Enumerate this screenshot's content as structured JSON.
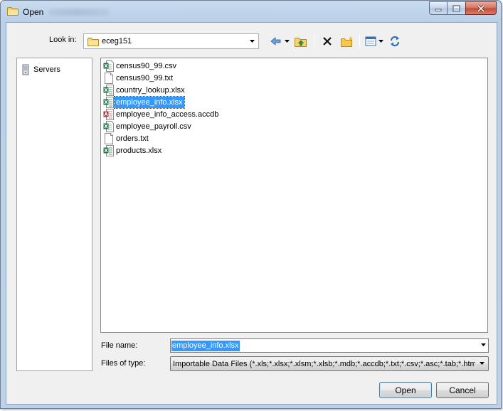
{
  "window": {
    "title": "Open",
    "minimize_icon": "minimize-icon",
    "maximize_icon": "maximize-icon",
    "close_icon": "close-icon"
  },
  "lookin": {
    "label": "Look in:",
    "value": "eceg151",
    "icon": "folder-icon"
  },
  "toolbar": {
    "buttons": [
      {
        "name": "back-button",
        "icon": "back-arrow-icon"
      },
      {
        "name": "up-folder-button",
        "icon": "up-folder-icon"
      },
      {
        "name": "delete-button",
        "icon": "delete-x-icon"
      },
      {
        "name": "new-folder-button",
        "icon": "new-folder-icon"
      },
      {
        "name": "views-button",
        "icon": "views-icon"
      },
      {
        "name": "refresh-button",
        "icon": "refresh-icon"
      }
    ]
  },
  "places": {
    "items": [
      {
        "label": "Servers",
        "icon": "server-icon"
      }
    ]
  },
  "files": [
    {
      "name": "census90_99.csv",
      "icon": "excel-csv-icon",
      "selected": false
    },
    {
      "name": "census90_99.txt",
      "icon": "text-file-icon",
      "selected": false
    },
    {
      "name": "country_lookup.xlsx",
      "icon": "excel-icon",
      "selected": false
    },
    {
      "name": "employee_info.xlsx",
      "icon": "excel-icon",
      "selected": true
    },
    {
      "name": "employee_info_access.accdb",
      "icon": "access-icon",
      "selected": false
    },
    {
      "name": "employee_payroll.csv",
      "icon": "excel-csv-icon",
      "selected": false
    },
    {
      "name": "orders.txt",
      "icon": "text-file-icon",
      "selected": false
    },
    {
      "name": "products.xlsx",
      "icon": "excel-icon",
      "selected": false
    }
  ],
  "filename": {
    "label": "File name:",
    "value": "employee_info.xlsx"
  },
  "filetype": {
    "label": "Files of type:",
    "value": "Importable Data Files (*.xls;*.xlsx;*.xlsm;*.xlsb;*.mdb;*.accdb;*.txt;*.csv;*.asc;*.tab;*.htm;*.h"
  },
  "buttons": {
    "open": "Open",
    "cancel": "Cancel"
  },
  "colors": {
    "selection": "#3399ff",
    "excel_green": "#1e7145",
    "access_red": "#a4373a"
  }
}
